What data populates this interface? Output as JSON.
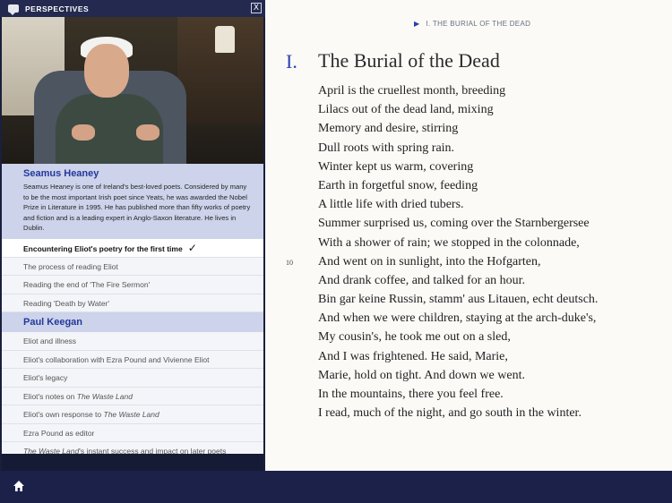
{
  "panel": {
    "title": "PERSPECTIVES",
    "close": "X",
    "bio": {
      "name": "Seamus Heaney",
      "text": "Seamus Heaney is one of Ireland's best-loved poets. Considered by many to be the most important Irish poet since Yeats, he was awarded the Nobel Prize in Literature in 1995. He has published more than fifty works of poetry and fiction and is a leading expert in Anglo-Saxon literature. He lives in Dublin."
    },
    "heaney_items": [
      "Encountering Eliot's poetry for the first time",
      "The process of reading Eliot",
      "Reading the end of 'The Fire Sermon'",
      "Reading 'Death by Water'"
    ],
    "section2": "Paul Keegan",
    "keegan_items": [
      {
        "pre": "Eliot and illness",
        "em": "",
        "post": ""
      },
      {
        "pre": "Eliot's collaboration with Ezra Pound and Vivienne Eliot",
        "em": "",
        "post": ""
      },
      {
        "pre": "Eliot's legacy",
        "em": "",
        "post": ""
      },
      {
        "pre": "Eliot's notes on ",
        "em": "The Waste Land",
        "post": ""
      },
      {
        "pre": "Eliot's own response to ",
        "em": "The Waste Land",
        "post": ""
      },
      {
        "pre": "Ezra Pound as editor",
        "em": "",
        "post": ""
      },
      {
        "pre": "",
        "em": "The Waste Land",
        "post": "'s instant success and impact on later poets"
      }
    ]
  },
  "reader": {
    "runner": "I. THE BURIAL OF THE DEAD",
    "section_number": "I.",
    "section_title": "The Burial of the Dead",
    "line_number": "10",
    "lines": [
      "April is the cruellest month, breeding",
      "Lilacs out of the dead land, mixing",
      "Memory and desire, stirring",
      "Dull roots with spring rain.",
      "Winter kept us warm, covering",
      "Earth in forgetful snow, feeding",
      "A little life with dried tubers.",
      "Summer surprised us, coming over the Starnbergersee",
      "With a shower of rain; we stopped in the colonnade,",
      "And went on in sunlight, into the Hofgarten,",
      "And drank coffee, and talked for an hour.",
      "Bin gar keine Russin, stamm' aus Litauen, echt deutsch.",
      "And when we were children, staying at the arch-duke's,",
      "My cousin's, he took me out on a sled,",
      "And I was frightened. He said, Marie,",
      "Marie, hold on tight. And down we went.",
      "In the mountains, there you feel free.",
      "I read, much of the night, and go south in the winter."
    ]
  },
  "colors": {
    "accent": "#2d3fb0",
    "panel_bg": "#1b1f3d",
    "section_bg": "#ccd3ea",
    "bottom_bar": "#1b2148"
  },
  "icons": {
    "header": "chat-bubble-icon",
    "close": "close-icon",
    "check": "checkmark-icon",
    "home": "home-icon",
    "runner": "triangle-right-icon"
  }
}
